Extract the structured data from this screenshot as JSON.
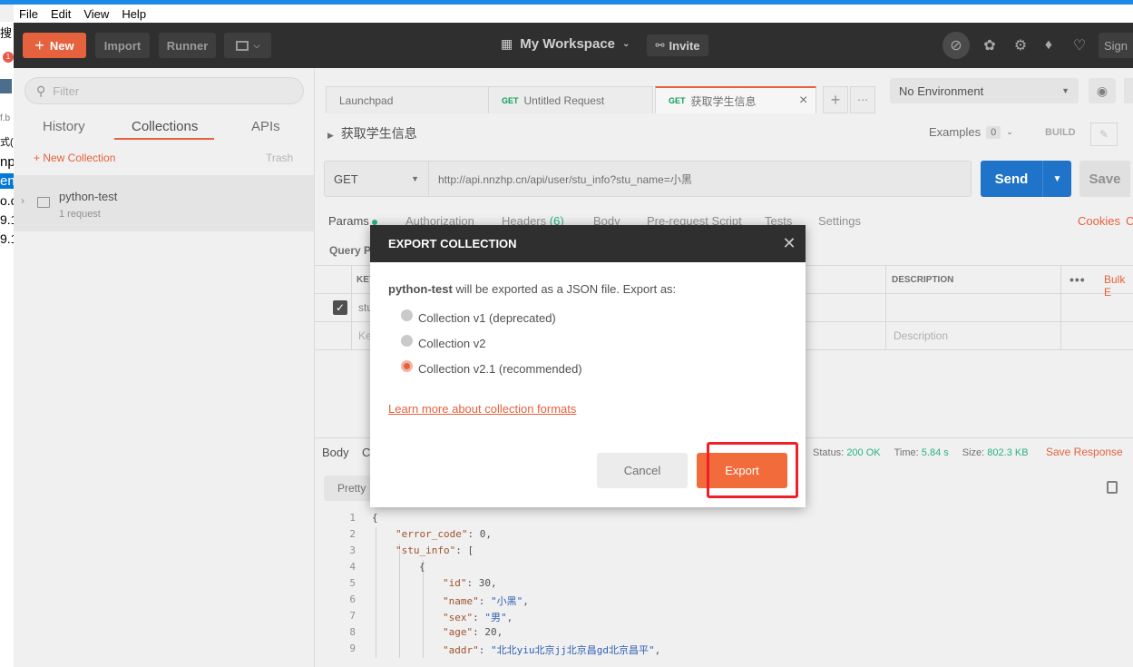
{
  "bg_window": {
    "fragments": [
      "搜",
      "1",
      "f.b",
      "式(",
      "np",
      "en",
      "o.c",
      "9.1",
      "9.1"
    ]
  },
  "menu": [
    "File",
    "Edit",
    "View",
    "Help"
  ],
  "header": {
    "new_label": "New",
    "import_label": "Import",
    "runner_label": "Runner",
    "workspace_label": "My Workspace",
    "invite_label": "Invite",
    "sign_label": "Sign"
  },
  "sidebar": {
    "filter_placeholder": "Filter",
    "tabs": [
      "History",
      "Collections",
      "APIs"
    ],
    "active_tab": "Collections",
    "new_collection_label": "+ New Collection",
    "trash_label": "Trash",
    "collections": [
      {
        "name": "python-test",
        "meta": "1 request"
      }
    ]
  },
  "tabs": [
    {
      "method": "",
      "label": "Launchpad"
    },
    {
      "method": "GET",
      "label": "Untitled Request"
    },
    {
      "method": "GET",
      "label": "获取学生信息"
    }
  ],
  "environment": "No Environment",
  "request": {
    "title": "获取学生信息",
    "examples_label": "Examples",
    "examples_count": "0",
    "build_label": "BUILD",
    "method": "GET",
    "url": "http://api.nnzhp.cn/api/user/stu_info?stu_name=小黑",
    "send_label": "Send",
    "save_label": "Save"
  },
  "req_tabs": {
    "params": "Params",
    "authorization": "Authorization",
    "headers": "Headers",
    "headers_count": "(6)",
    "body": "Body",
    "prerequest": "Pre-request Script",
    "tests": "Tests",
    "settings": "Settings",
    "cookies": "Cookies",
    "code": "C"
  },
  "params_table": {
    "section": "Query P",
    "key_header": "KEY",
    "desc_header": "DESCRIPTION",
    "bulk_edit": "Bulk E",
    "row_key": "stu",
    "key_placeholder": "Ke",
    "desc_placeholder": "Description"
  },
  "response": {
    "body_tab": "Body",
    "cookies_tab": "C",
    "status_label": "Status:",
    "status_value": "200 OK",
    "time_label": "Time:",
    "time_value": "5.84 s",
    "size_label": "Size:",
    "size_value": "802.3 KB",
    "save_response": "Save Response",
    "pretty_label": "Pretty"
  },
  "code_lines": [
    {
      "n": "1",
      "indent": 0,
      "key": "",
      "text": "{"
    },
    {
      "n": "2",
      "indent": 1,
      "key": "\"error_code\"",
      "text": ": 0,"
    },
    {
      "n": "3",
      "indent": 1,
      "key": "\"stu_info\"",
      "text": ": ["
    },
    {
      "n": "4",
      "indent": 2,
      "key": "",
      "text": "{"
    },
    {
      "n": "5",
      "indent": 3,
      "key": "\"id\"",
      "text": ": 30,"
    },
    {
      "n": "6",
      "indent": 3,
      "key": "\"name\"",
      "text": ": \"小黑\","
    },
    {
      "n": "7",
      "indent": 3,
      "key": "\"sex\"",
      "text": ": \"男\","
    },
    {
      "n": "8",
      "indent": 3,
      "key": "\"age\"",
      "text": ": 20,"
    },
    {
      "n": "9",
      "indent": 3,
      "key": "\"addr\"",
      "text": ": \"北北yiu北京jj北京昌gd北京昌平\","
    }
  ],
  "modal": {
    "title": "EXPORT COLLECTION",
    "collection_name": "python-test",
    "message_rest": " will be exported as a JSON file. Export as:",
    "options": [
      {
        "label": "Collection v1 (deprecated)",
        "selected": false
      },
      {
        "label": "Collection v2",
        "selected": false
      },
      {
        "label": "Collection v2.1 (recommended)",
        "selected": true
      }
    ],
    "learn_more": "Learn more about collection formats",
    "cancel_label": "Cancel",
    "export_label": "Export"
  }
}
